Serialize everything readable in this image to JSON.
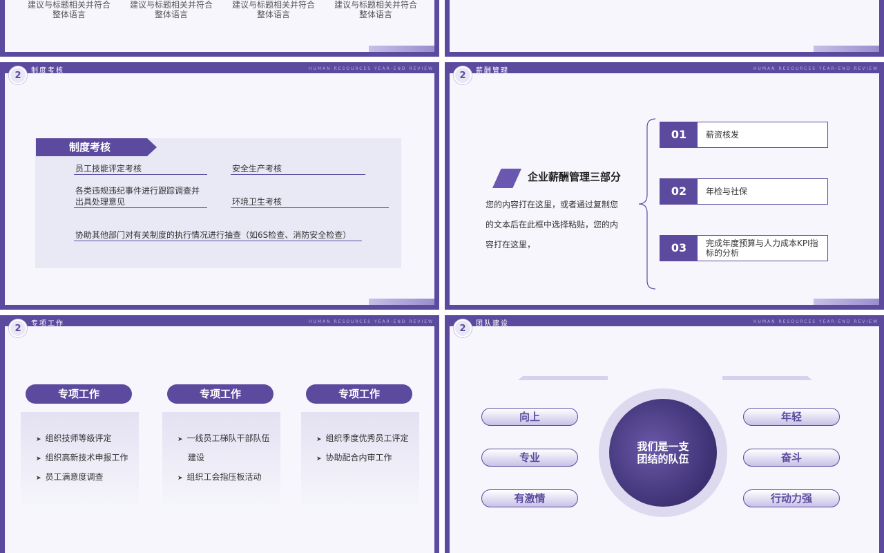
{
  "slide0": {
    "texts": [
      "建议与标题相关并符合\n整体语言",
      "建议与标题相关并符合\n整体语言",
      "建议与标题相关并符合\n整体语言",
      "建议与标题相关并符合\n整体语言"
    ]
  },
  "header": {
    "eng": "HUMAN RESOURCES YEAR-END REVIEW",
    "badge": "2"
  },
  "slide2": {
    "title": "制度考核",
    "tag": "制度考核",
    "items": [
      "员工技能评定考核",
      "安全生产考核",
      "各类违规违纪事件进行跟踪调查并\n出具处理意见",
      "环境卫生考核",
      "协助其他部门对有关制度的执行情况进行抽查（如6S检查、消防安全检查）"
    ]
  },
  "slide3": {
    "title": "薪酬管理",
    "heading": "企业薪酬管理三部分",
    "paragraph": "您的内容打在这里，或者通过复制您的文本后在此框中选择粘贴，您的内容打在这里，",
    "items": [
      {
        "num": "01",
        "label": "薪资核发"
      },
      {
        "num": "02",
        "label": "年检与社保"
      },
      {
        "num": "03",
        "label": "完成年度预算与人力成本KPI指标的分析"
      }
    ]
  },
  "slide4": {
    "title": "专项工作",
    "columns": [
      {
        "pill": "专项工作",
        "lines": [
          "组织技师等级评定",
          "组织高新技术申报工作",
          "员工满意度调查"
        ]
      },
      {
        "pill": "专项工作",
        "lines": [
          "一线员工梯队干部队伍",
          "建设",
          "组织工会指压板活动"
        ]
      },
      {
        "pill": "专项工作",
        "lines": [
          "组织季度优秀员工评定",
          "协助配合内审工作"
        ]
      }
    ]
  },
  "slide5": {
    "title": "团队建设",
    "center": "我们是一支\n团结的队伍",
    "left": [
      "向上",
      "专业",
      "有激情"
    ],
    "right": [
      "年轻",
      "奋斗",
      "行动力强"
    ]
  },
  "colors": {
    "accent": "#5b4a9e",
    "light": "#f6f6fc"
  }
}
